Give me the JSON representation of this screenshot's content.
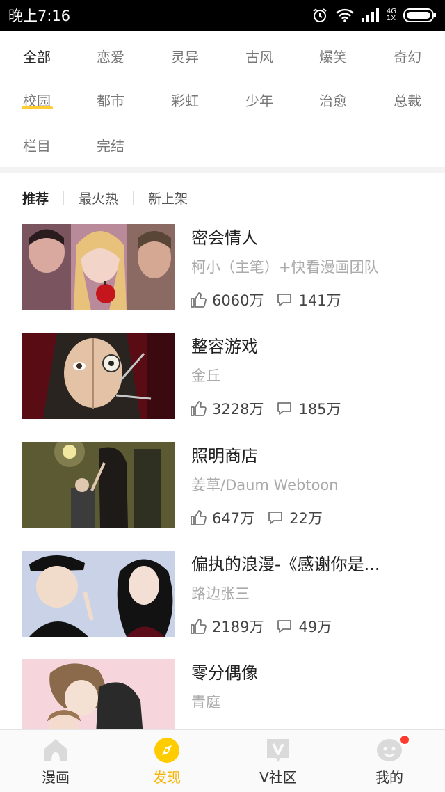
{
  "status_bar": {
    "time": "晚上7:16",
    "network_top": "4G",
    "network_bottom": "1X"
  },
  "categories": [
    "全部",
    "恋爱",
    "灵异",
    "古风",
    "爆笑",
    "奇幻",
    "校园",
    "都市",
    "彩虹",
    "少年",
    "治愈",
    "总裁",
    "栏目",
    "完结"
  ],
  "active_category": "全部",
  "sub_tabs": [
    "推荐",
    "最火热",
    "新上架"
  ],
  "active_sub_tab": "推荐",
  "comics": [
    {
      "title": "密会情人",
      "author": "柯小（主笔）+快看漫画团队",
      "likes": "6060万",
      "comments": "141万"
    },
    {
      "title": "整容游戏",
      "author": "金丘",
      "likes": "3228万",
      "comments": "185万"
    },
    {
      "title": "照明商店",
      "author": "姜草/Daum Webtoon",
      "likes": "647万",
      "comments": "22万"
    },
    {
      "title": "偏执的浪漫-《感谢你是...",
      "author": "路边张三",
      "likes": "2189万",
      "comments": "49万"
    },
    {
      "title": "零分偶像",
      "author": "青庭",
      "likes": "",
      "comments": ""
    }
  ],
  "bottom_nav": [
    {
      "label": "漫画",
      "icon": "home-icon"
    },
    {
      "label": "发现",
      "icon": "discover-icon"
    },
    {
      "label": "V社区",
      "icon": "v-community-icon"
    },
    {
      "label": "我的",
      "icon": "profile-icon"
    }
  ],
  "active_nav": "发现",
  "colors": {
    "accent": "#ffcc33",
    "active_nav": "#f5b400",
    "badge": "#ff3b30"
  }
}
